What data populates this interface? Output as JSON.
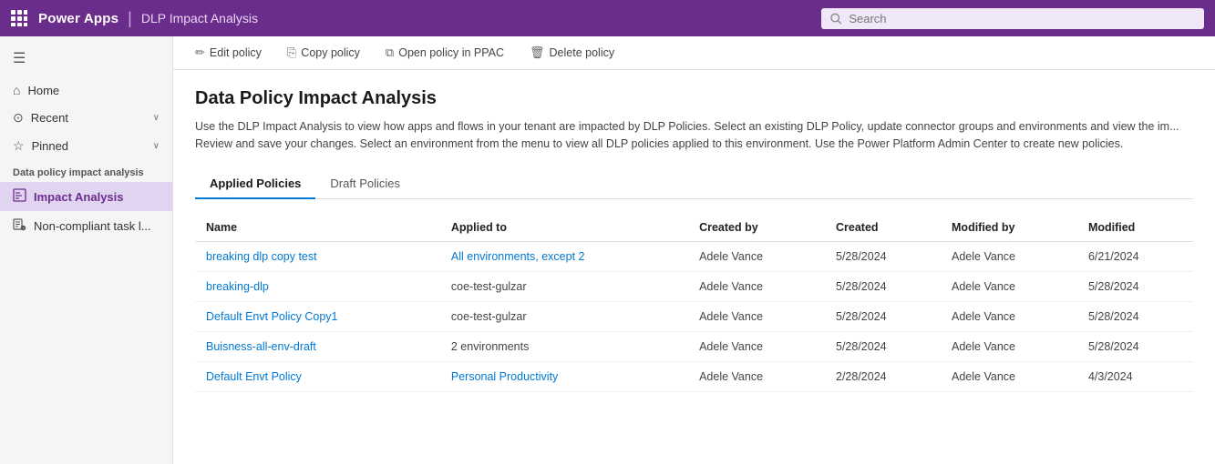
{
  "topnav": {
    "app_title": "Power Apps",
    "separator": "|",
    "page_title": "DLP Impact Analysis",
    "search_placeholder": "Search"
  },
  "sidebar": {
    "hamburger_icon": "☰",
    "home_label": "Home",
    "recent_label": "Recent",
    "pinned_label": "Pinned",
    "section_label": "Data policy impact analysis",
    "items": [
      {
        "label": "Impact Analysis",
        "active": true
      },
      {
        "label": "Non-compliant task l...",
        "active": false
      }
    ]
  },
  "toolbar": {
    "buttons": [
      {
        "icon": "✏",
        "label": "Edit policy"
      },
      {
        "icon": "⎘",
        "label": "Copy policy"
      },
      {
        "icon": "⧉",
        "label": "Open policy in PPAC"
      },
      {
        "icon": "🗑",
        "label": "Delete policy"
      }
    ]
  },
  "main": {
    "title": "Data Policy Impact Analysis",
    "description": "Use the DLP Impact Analysis to view how apps and flows in your tenant are impacted by DLP Policies. Select an existing DLP Policy, update connector groups and environments and view the im... Review and save your changes. Select an environment from the menu to view all DLP policies applied to this environment. Use the Power Platform Admin Center to create new policies.",
    "tabs": [
      {
        "label": "Applied Policies",
        "active": true
      },
      {
        "label": "Draft Policies",
        "active": false
      }
    ],
    "table": {
      "columns": [
        "Name",
        "Applied to",
        "Created by",
        "Created",
        "Modified by",
        "Modified"
      ],
      "rows": [
        {
          "name": "breaking dlp copy test",
          "applied_to": "All environments, except 2",
          "created_by": "Adele Vance",
          "created": "5/28/2024",
          "modified_by": "Adele Vance",
          "modified": "6/21/2024",
          "name_link": true,
          "applied_link": true
        },
        {
          "name": "breaking-dlp",
          "applied_to": "coe-test-gulzar",
          "created_by": "Adele Vance",
          "created": "5/28/2024",
          "modified_by": "Adele Vance",
          "modified": "5/28/2024",
          "name_link": true,
          "applied_link": false
        },
        {
          "name": "Default Envt Policy Copy1",
          "applied_to": "coe-test-gulzar",
          "created_by": "Adele Vance",
          "created": "5/28/2024",
          "modified_by": "Adele Vance",
          "modified": "5/28/2024",
          "name_link": true,
          "applied_link": false
        },
        {
          "name": "Buisness-all-env-draft",
          "applied_to": "2 environments",
          "created_by": "Adele Vance",
          "created": "5/28/2024",
          "modified_by": "Adele Vance",
          "modified": "5/28/2024",
          "name_link": true,
          "applied_link": false
        },
        {
          "name": "Default Envt Policy",
          "applied_to": "Personal Productivity",
          "created_by": "Adele Vance",
          "created": "2/28/2024",
          "modified_by": "Adele Vance",
          "modified": "4/3/2024",
          "name_link": true,
          "applied_link": true
        }
      ]
    }
  }
}
